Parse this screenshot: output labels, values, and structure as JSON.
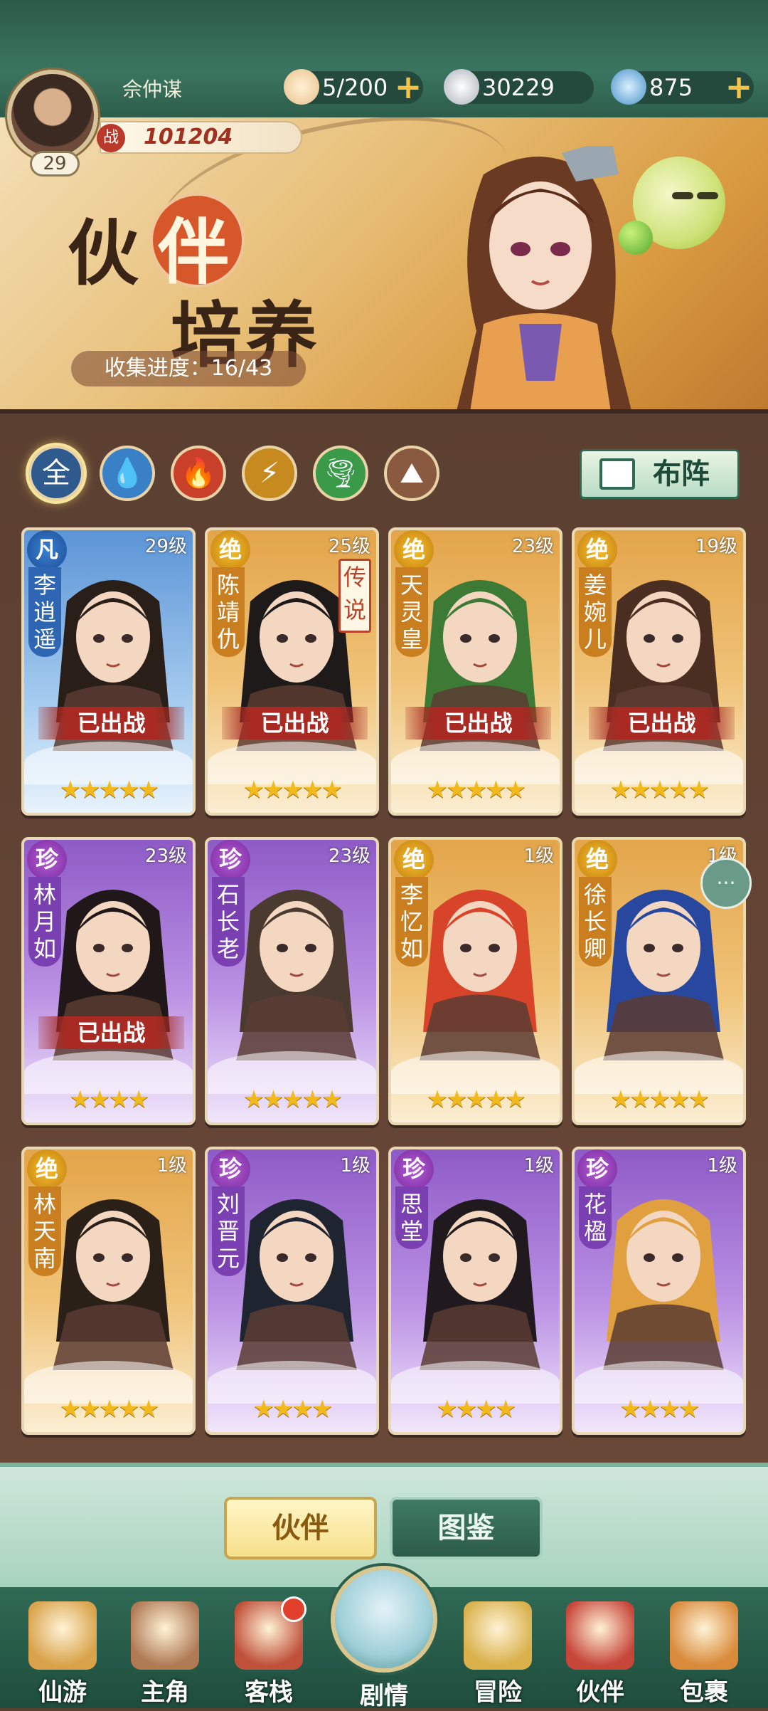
{
  "player": {
    "name": "佘仲谋",
    "level": "29",
    "power": "101204",
    "power_icon": "战"
  },
  "resources": [
    {
      "name": "bun",
      "value": "5/200",
      "icon": "bun-icon",
      "color": "#e9c08a"
    },
    {
      "name": "coin",
      "value": "30229",
      "icon": "coin-icon",
      "color": "#c9ccd4"
    },
    {
      "name": "spirit",
      "value": "875",
      "icon": "spirit-swirl-icon",
      "color": "#6db6d8"
    }
  ],
  "banner": {
    "title_1": "伙",
    "title_2": "伴",
    "title_3": "培养",
    "collection": "收集进度：16/43"
  },
  "filters": [
    {
      "label": "全",
      "color": "#2e5a8e",
      "icon": "all-icon"
    },
    {
      "label": "💧",
      "color": "#3a80c7",
      "icon": "water-icon"
    },
    {
      "label": "🔥",
      "color": "#c8402a",
      "icon": "fire-icon"
    },
    {
      "label": "⚡",
      "color": "#c78a1f",
      "icon": "thunder-icon"
    },
    {
      "label": "🌪",
      "color": "#3a9a4a",
      "icon": "wind-icon"
    },
    {
      "label": "⛰",
      "color": "#8a5a40",
      "icon": "earth-icon"
    }
  ],
  "formation_button": "布阵",
  "cards": [
    {
      "grade": "凡",
      "name": "李逍遥",
      "level": "29级",
      "tier": "blue",
      "stars": 5,
      "deployed": "已出战",
      "legend": ""
    },
    {
      "grade": "绝",
      "name": "陈靖仇",
      "level": "25级",
      "tier": "gold",
      "stars": 5,
      "deployed": "已出战",
      "legend": "传说"
    },
    {
      "grade": "绝",
      "name": "天灵皇",
      "level": "23级",
      "tier": "gold",
      "stars": 5,
      "deployed": "已出战",
      "legend": ""
    },
    {
      "grade": "绝",
      "name": "姜婉儿",
      "level": "19级",
      "tier": "gold",
      "stars": 5,
      "deployed": "已出战",
      "legend": ""
    },
    {
      "grade": "珍",
      "name": "林月如",
      "level": "23级",
      "tier": "purple",
      "stars": 4,
      "deployed": "已出战",
      "legend": ""
    },
    {
      "grade": "珍",
      "name": "石长老",
      "level": "23级",
      "tier": "purple",
      "stars": 5,
      "deployed": "",
      "legend": ""
    },
    {
      "grade": "绝",
      "name": "李忆如",
      "level": "1级",
      "tier": "gold",
      "stars": 5,
      "deployed": "",
      "legend": ""
    },
    {
      "grade": "绝",
      "name": "徐长卿",
      "level": "1级",
      "tier": "gold",
      "stars": 5,
      "deployed": "",
      "legend": ""
    },
    {
      "grade": "绝",
      "name": "林天南",
      "level": "1级",
      "tier": "gold",
      "stars": 5,
      "deployed": "",
      "legend": ""
    },
    {
      "grade": "珍",
      "name": "刘晋元",
      "level": "1级",
      "tier": "purple",
      "stars": 4,
      "deployed": "",
      "legend": ""
    },
    {
      "grade": "珍",
      "name": "思堂",
      "level": "1级",
      "tier": "purple",
      "stars": 4,
      "deployed": "",
      "legend": ""
    },
    {
      "grade": "珍",
      "name": "花楹",
      "level": "1级",
      "tier": "purple",
      "stars": 4,
      "deployed": "",
      "legend": ""
    }
  ],
  "chat_icon": "chat-bubble-icon",
  "tabs": {
    "active": "伙伴",
    "inactive": "图鉴"
  },
  "nav": [
    {
      "label": "仙游",
      "icon": "scroll-icon",
      "color": "#d9a24a"
    },
    {
      "label": "主角",
      "icon": "hero-icon",
      "color": "#b07a55"
    },
    {
      "label": "客栈",
      "icon": "inn-icon",
      "color": "#c0503a"
    },
    {
      "label": "剧情",
      "icon": "story-icon",
      "color": "#9fcfd8"
    },
    {
      "label": "冒险",
      "icon": "gourd-icon",
      "color": "#d9b04a"
    },
    {
      "label": "伙伴",
      "icon": "partner-icon",
      "color": "#c7463a"
    },
    {
      "label": "包裹",
      "icon": "bag-icon",
      "color": "#d98a3a"
    }
  ]
}
